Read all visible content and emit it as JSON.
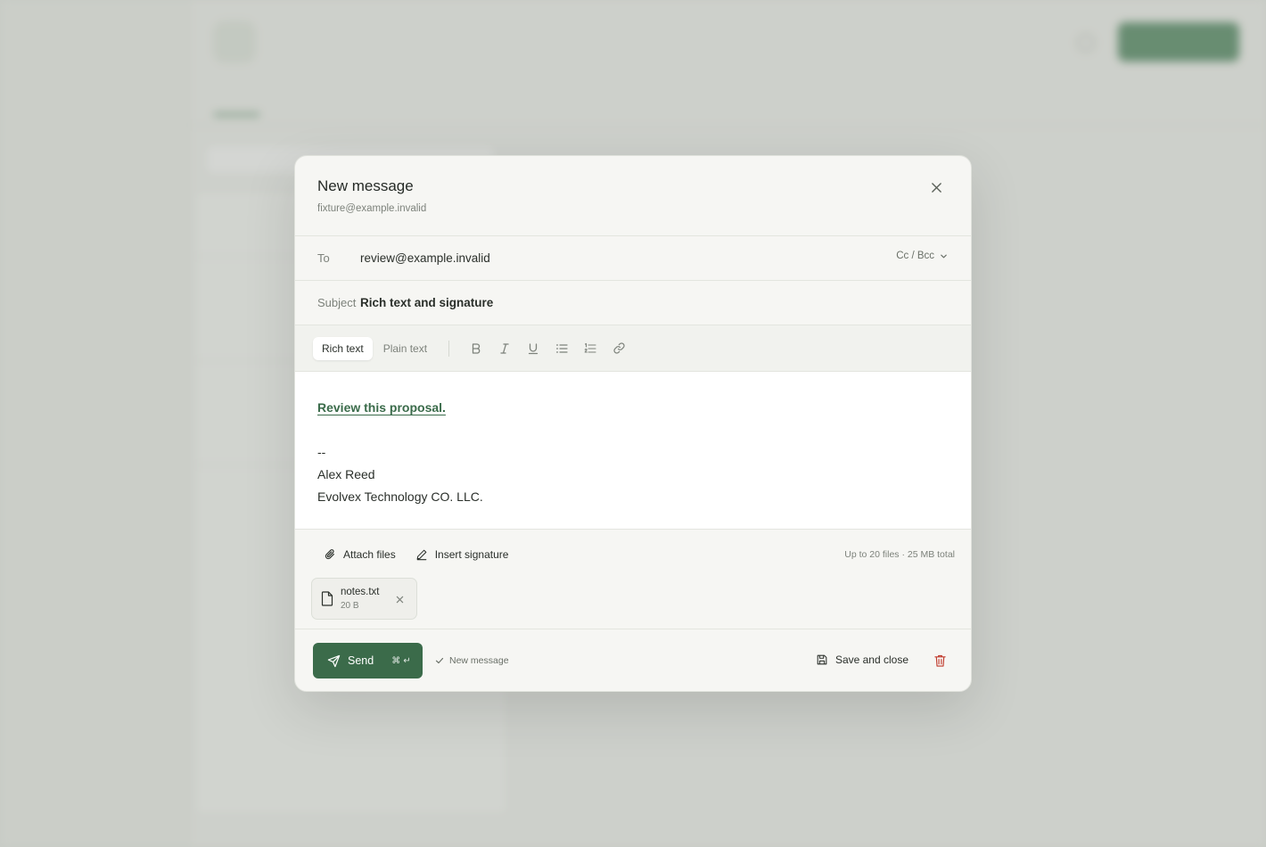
{
  "modal": {
    "title": "New message",
    "sender": "fixture@example.invalid",
    "to_label": "To",
    "to_value": "review@example.invalid",
    "cc_bcc_label": "Cc / Bcc",
    "subject_label": "Subject",
    "subject_value": "Rich text and signature",
    "toolbar": {
      "rich_text_label": "Rich text",
      "plain_text_label": "Plain text",
      "buttons": [
        "bold-icon",
        "italic-icon",
        "underline-icon",
        "bullet-list-icon",
        "numbered-list-icon",
        "link-icon"
      ]
    },
    "body": {
      "link_text": "Review this proposal.",
      "signature_separator": "--",
      "signature_name": "Alex Reed",
      "signature_company": "Evolvex Technology CO. LLC."
    },
    "attachments": {
      "attach_label": "Attach files",
      "insert_signature_label": "Insert signature",
      "limit_note": "Up to 20 files · 25 MB total",
      "files": [
        {
          "name": "notes.txt",
          "size": "20 B"
        }
      ]
    },
    "footer": {
      "send_label": "Send",
      "send_shortcut": "⌘ ↵",
      "status_text": "New message",
      "save_close_label": "Save and close"
    }
  },
  "colors": {
    "accent": "#3b6b4a",
    "link": "#3a6b4a",
    "delete": "#c0392b"
  }
}
